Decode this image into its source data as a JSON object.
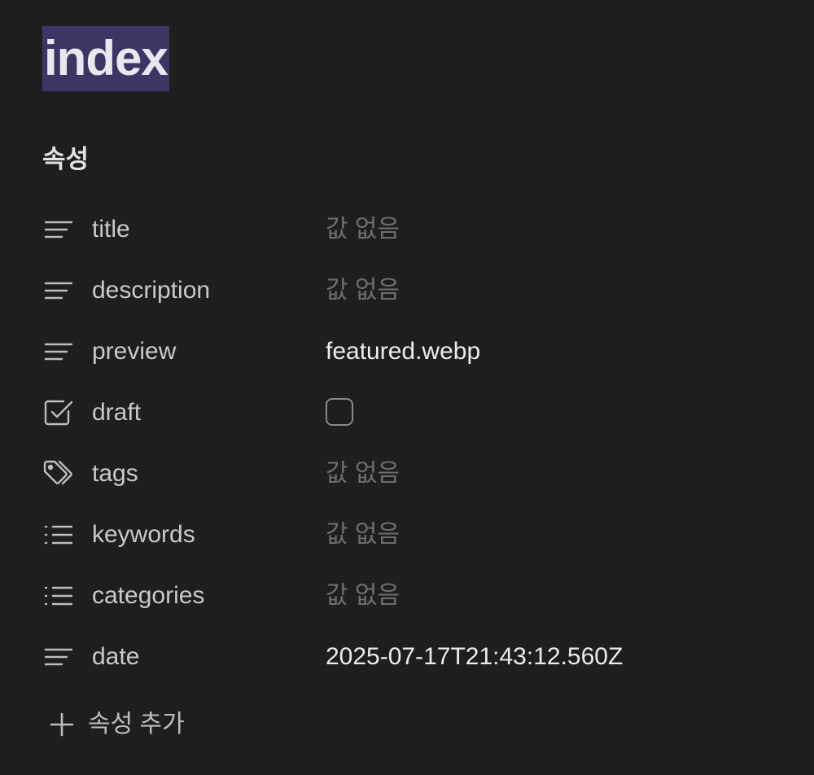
{
  "note": {
    "title": "index"
  },
  "properties": {
    "heading": "속성",
    "empty_placeholder": "값 없음",
    "add_label": "속성 추가",
    "items": [
      {
        "key": "title",
        "type": "text",
        "icon": "text-lines-icon",
        "value": "값 없음",
        "empty": true
      },
      {
        "key": "description",
        "type": "text",
        "icon": "text-lines-icon",
        "value": "값 없음",
        "empty": true
      },
      {
        "key": "preview",
        "type": "text",
        "icon": "text-lines-icon",
        "value": "featured.webp",
        "empty": false
      },
      {
        "key": "draft",
        "type": "checkbox",
        "icon": "checkbox-icon",
        "checked": false
      },
      {
        "key": "tags",
        "type": "tags",
        "icon": "tags-icon",
        "value": "값 없음",
        "empty": true
      },
      {
        "key": "keywords",
        "type": "list",
        "icon": "list-icon",
        "value": "값 없음",
        "empty": true
      },
      {
        "key": "categories",
        "type": "list",
        "icon": "list-icon",
        "value": "값 없음",
        "empty": true
      },
      {
        "key": "date",
        "type": "text",
        "icon": "text-lines-icon",
        "value": "2025-07-17T21:43:12.560Z",
        "empty": false
      }
    ]
  },
  "colors": {
    "background": "#1e1e1e",
    "title_highlight": "#3f3564",
    "muted_text": "#6e6e6e",
    "key_text": "#c9c9c9",
    "value_text": "#ececec"
  }
}
